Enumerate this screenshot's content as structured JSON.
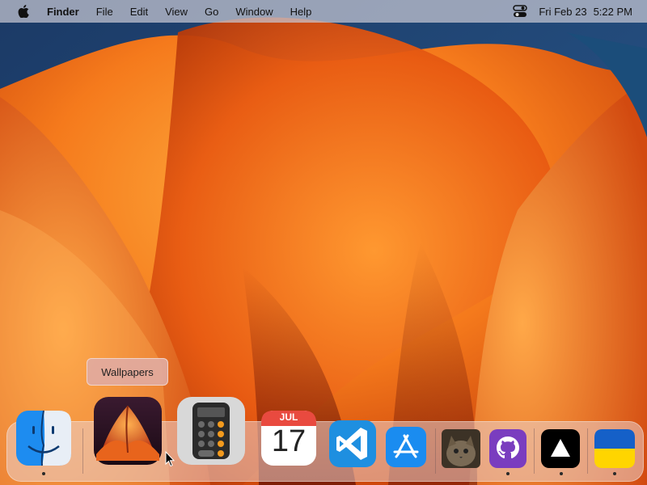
{
  "menubar": {
    "apple_icon": "apple-logo-icon",
    "app_name": "Finder",
    "menus": [
      "File",
      "Edit",
      "View",
      "Go",
      "Window",
      "Help"
    ],
    "control_center_icon": "control-center-icon",
    "date": "Fri Feb 23",
    "time": "5:22 PM"
  },
  "tooltip": {
    "label": "Wallpapers"
  },
  "dock": {
    "items": [
      {
        "icon": "finder-icon",
        "running": true
      },
      {
        "icon": "wallpapers-icon",
        "running": false
      },
      {
        "icon": "calculator-icon",
        "running": false
      },
      {
        "icon": "calendar-icon",
        "running": false,
        "month": "JUL",
        "day": "17"
      },
      {
        "icon": "vscode-icon",
        "running": false
      },
      {
        "icon": "app-store-icon",
        "running": false
      },
      {
        "icon": "cat-photo-icon",
        "running": false
      },
      {
        "icon": "github-icon",
        "running": true
      },
      {
        "icon": "triangle-app-icon",
        "running": true
      },
      {
        "icon": "ukraine-flag-icon",
        "running": true
      }
    ]
  },
  "colors": {
    "wallpaper_orange": "#f0701a",
    "wallpaper_blue": "#1e4d80",
    "calendar_red": "#e94a3f",
    "vscode_blue": "#1e8fe0",
    "appstore_blue": "#1a8cf0",
    "github_purple": "#7a3dbf",
    "flag_blue": "#1560c8",
    "flag_yellow": "#ffd500"
  }
}
